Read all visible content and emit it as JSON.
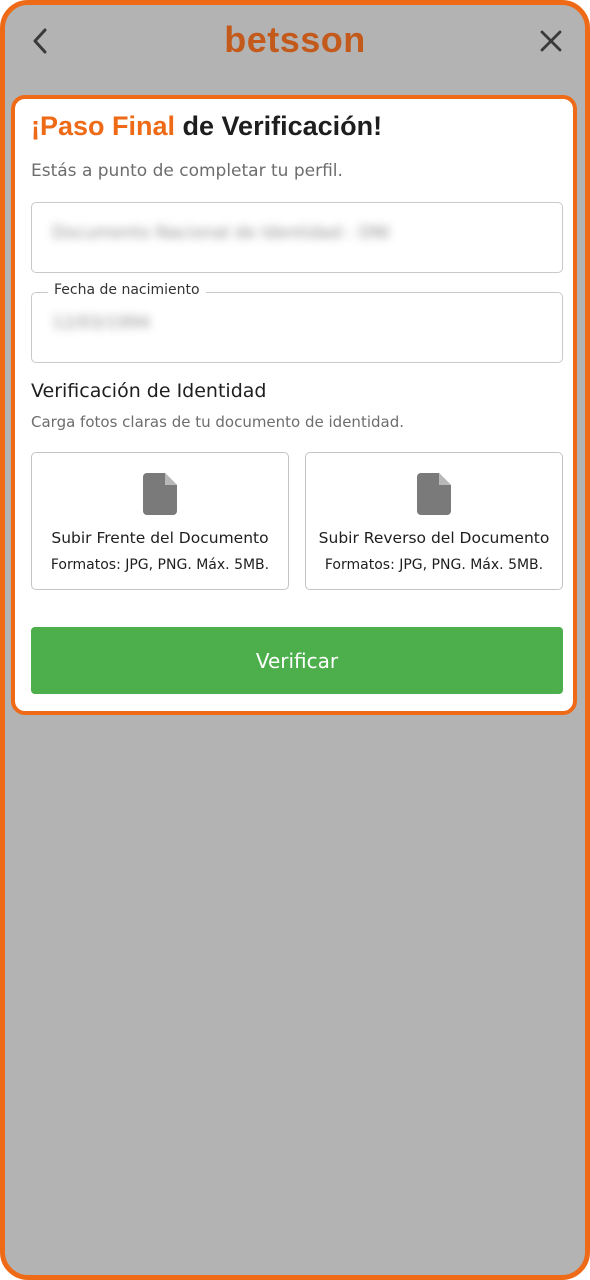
{
  "header": {
    "logo_text": "betsson",
    "logo_color": "#c35a1b",
    "back_icon": "chevron-left-icon",
    "close_icon": "close-icon"
  },
  "card": {
    "title_accent": "¡Paso Final",
    "title_rest": " de Verificación!",
    "subtitle": "Estás a punto de completar tu perfil.",
    "document_field": {
      "value": "Documento Nacional de Identidad - DNI"
    },
    "birthdate_field": {
      "label": "Fecha de nacimiento",
      "value": "12/03/1994"
    },
    "identity_section": {
      "heading": "Verificación de Identidad",
      "description": "Carga fotos claras de tu documento de identidad."
    },
    "uploads": [
      {
        "title": "Subir Frente del Documento",
        "formats": "Formatos: JPG, PNG. Máx. 5MB.",
        "icon": "file-icon"
      },
      {
        "title": "Subir Reverso del Documento",
        "formats": "Formatos: JPG, PNG. Máx. 5MB.",
        "icon": "file-icon"
      }
    ],
    "verify_button": "Verificar"
  },
  "colors": {
    "accent": "#ee6a17",
    "button_green": "#4caf4c",
    "backdrop": "#b3b3b3"
  }
}
